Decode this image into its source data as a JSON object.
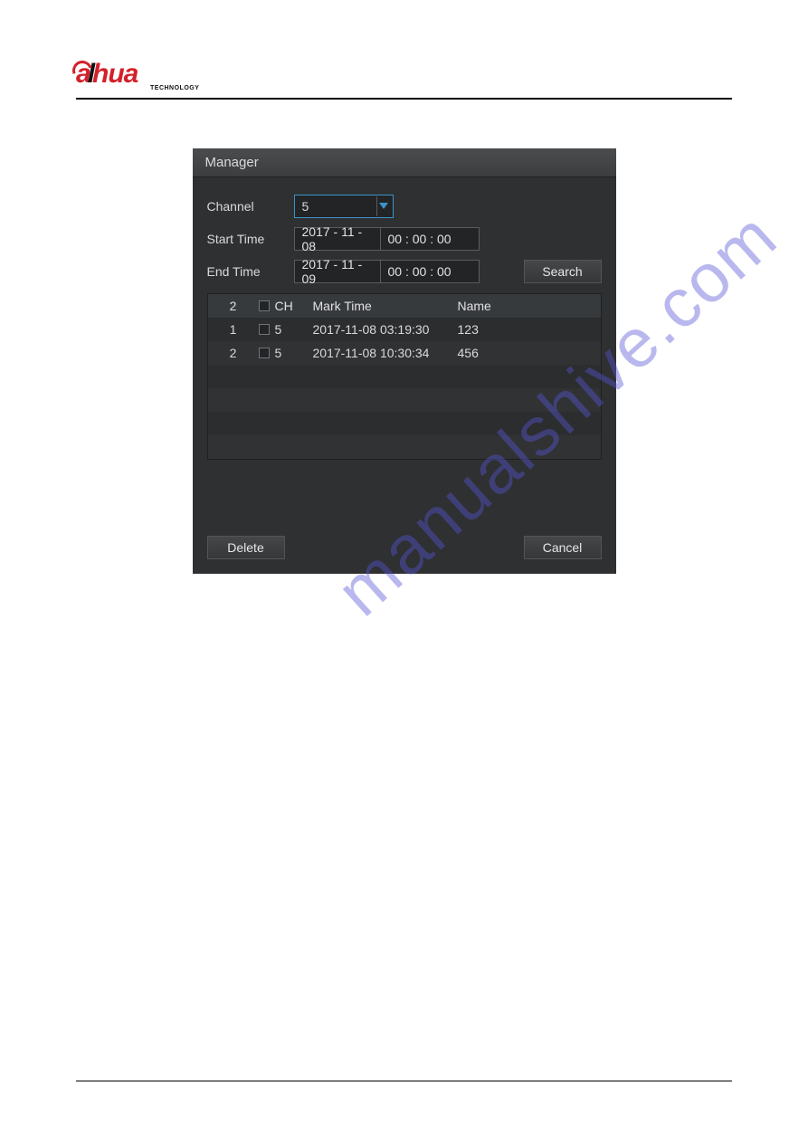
{
  "brand": {
    "name_part1": "a",
    "name_part2": "l",
    "name_part3": "hua",
    "subtitle": "TECHNOLOGY"
  },
  "dialog": {
    "title": "Manager",
    "labels": {
      "channel": "Channel",
      "start_time": "Start Time",
      "end_time": "End Time"
    },
    "channel_value": "5",
    "start_date": "2017 - 11 - 08",
    "start_time": "00 : 00 : 00",
    "end_date": "2017 - 11 - 09",
    "end_time": "00 : 00 : 00",
    "buttons": {
      "search": "Search",
      "delete": "Delete",
      "cancel": "Cancel"
    },
    "table": {
      "count": "2",
      "headers": {
        "ch": "CH",
        "mark_time": "Mark Time",
        "name": "Name"
      },
      "rows": [
        {
          "index": "1",
          "ch": "5",
          "mark_time": "2017-11-08 03:19:30",
          "name": "123"
        },
        {
          "index": "2",
          "ch": "5",
          "mark_time": "2017-11-08 10:30:34",
          "name": "456"
        }
      ]
    }
  },
  "watermark": "manualshive.com"
}
